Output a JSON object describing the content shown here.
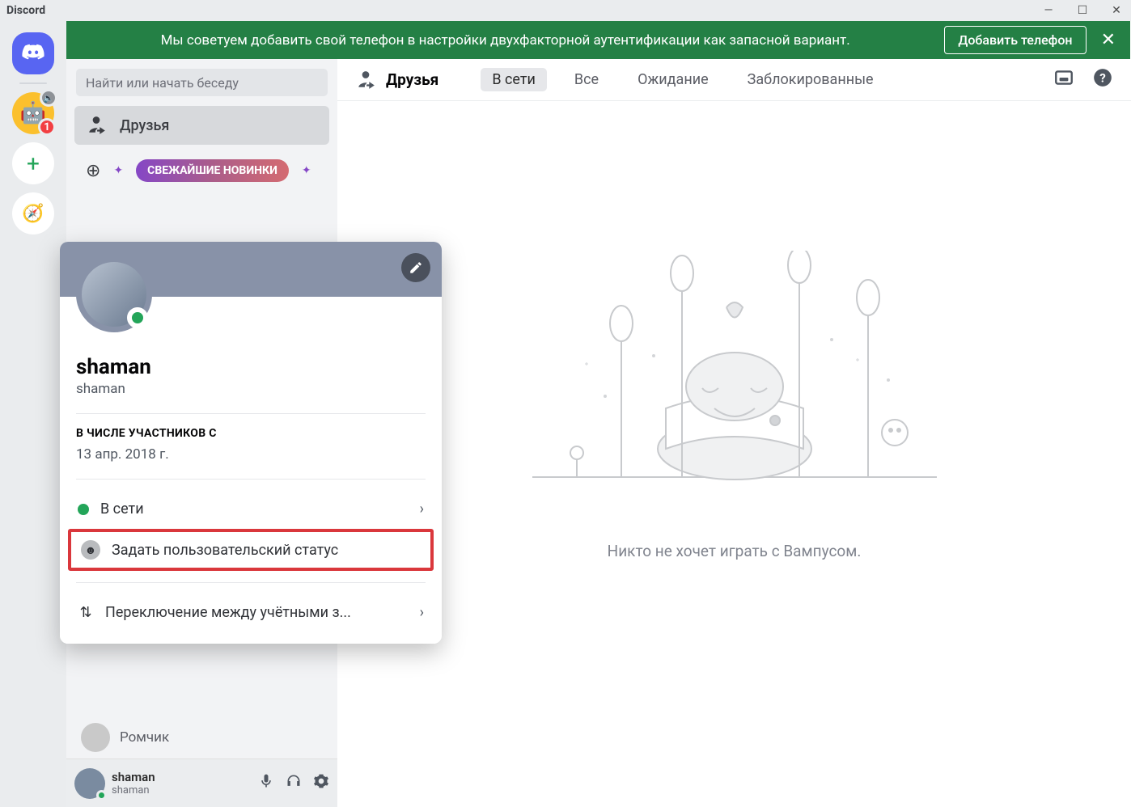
{
  "titlebar": {
    "app_name": "Discord"
  },
  "notice": {
    "text": "Мы советуем добавить свой телефон в настройки двухфакторной аутентификации как запасной вариант.",
    "button": "Добавить телефон"
  },
  "servers": {
    "badge_count": "1"
  },
  "search": {
    "placeholder": "Найти или начать беседу"
  },
  "nav": {
    "friends": "Друзья",
    "nitro_icon": "nitro",
    "nitro_label": "СВЕЖАЙШИЕ НОВИНКИ"
  },
  "dms": {
    "visible_name": "Ромчик"
  },
  "header": {
    "title": "Друзья",
    "tabs": {
      "online": "В сети",
      "all": "Все",
      "pending": "Ожидание",
      "blocked": "Заблокированные"
    }
  },
  "empty": {
    "text": "Никто не хочет играть с Вампусом."
  },
  "popout": {
    "display_name": "shaman",
    "username": "shaman",
    "member_since_label": "В ЧИСЛЕ УЧАСТНИКОВ С",
    "member_since_value": "13 апр. 2018 г.",
    "status_text": "В сети",
    "custom_status": "Задать пользовательский статус",
    "switch_account": "Переключение между учётными з..."
  },
  "user_panel": {
    "name": "shaman",
    "sub": "shaman"
  }
}
